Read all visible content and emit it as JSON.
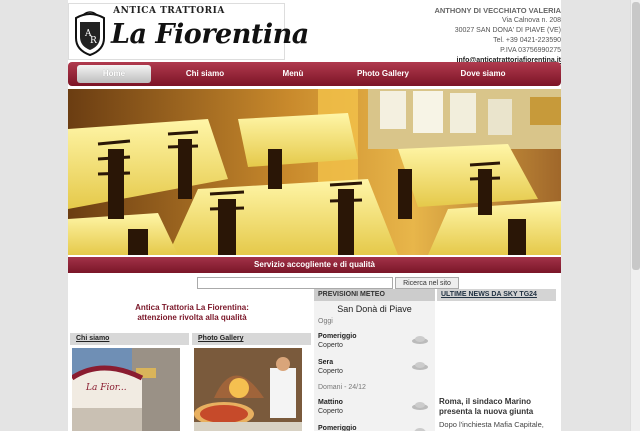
{
  "logo": {
    "top_text": "ANTICA TRATTORIA",
    "name": "La Fiorentina"
  },
  "contact": {
    "owner": "ANTHONY DI VECCHIATO VALERIA",
    "street": "Via Calnova n. 208",
    "city": "30027 SAN DONA' DI PIAVE (VE)",
    "tel": "Tel. +39 0421-223590",
    "piva": "P.IVA 03756990275",
    "email": "info@anticatrattoriafiorentina.it"
  },
  "nav": {
    "items": [
      "Home",
      "Chi siamo",
      "Menù",
      "Photo Gallery",
      "Dove siamo"
    ],
    "active": "Home"
  },
  "slogan": "Servizio accogliente e di qualità",
  "search": {
    "value": "",
    "button": "Ricerca nel sito"
  },
  "intro": {
    "line1": "Antica Trattoria La Fiorentina:",
    "line2": "attenzione rivolta alla qualità"
  },
  "thumbs": {
    "chi_siamo": "Chi siamo",
    "gallery": "Photo Gallery"
  },
  "meteo": {
    "title": "PREVISIONI METEO",
    "city": "San Donà di Piave",
    "day1": "Oggi",
    "day2": "Domani - 24/12",
    "rows": [
      {
        "period": "Pomeriggio",
        "cond": "Coperto"
      },
      {
        "period": "Sera",
        "cond": "Coperto"
      },
      {
        "period": "Mattino",
        "cond": "Coperto"
      },
      {
        "period": "Pomeriggio",
        "cond": ""
      }
    ]
  },
  "news": {
    "title": "ULTIME NEWS DA SKY TG24",
    "headline": "Roma, il sindaco Marino presenta la nuova giunta",
    "snippet": "Dopo l'inchiesta Mafia Capitale,"
  },
  "colors": {
    "brand": "#8a1c30",
    "nav_top": "#b03a4e",
    "nav_bottom": "#7c1426"
  }
}
